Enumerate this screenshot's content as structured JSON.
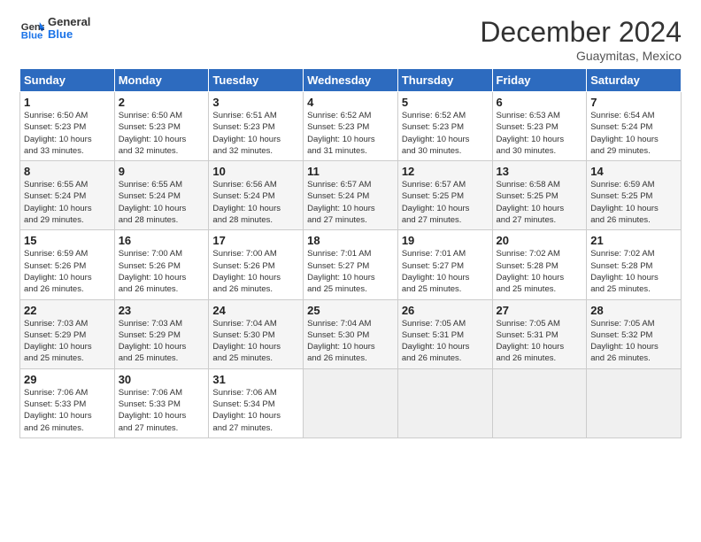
{
  "logo": {
    "line1": "General",
    "line2": "Blue"
  },
  "title": "December 2024",
  "location": "Guaymitas, Mexico",
  "days_header": [
    "Sunday",
    "Monday",
    "Tuesday",
    "Wednesday",
    "Thursday",
    "Friday",
    "Saturday"
  ],
  "weeks": [
    [
      {
        "day": "1",
        "info": "Sunrise: 6:50 AM\nSunset: 5:23 PM\nDaylight: 10 hours\nand 33 minutes."
      },
      {
        "day": "2",
        "info": "Sunrise: 6:50 AM\nSunset: 5:23 PM\nDaylight: 10 hours\nand 32 minutes."
      },
      {
        "day": "3",
        "info": "Sunrise: 6:51 AM\nSunset: 5:23 PM\nDaylight: 10 hours\nand 32 minutes."
      },
      {
        "day": "4",
        "info": "Sunrise: 6:52 AM\nSunset: 5:23 PM\nDaylight: 10 hours\nand 31 minutes."
      },
      {
        "day": "5",
        "info": "Sunrise: 6:52 AM\nSunset: 5:23 PM\nDaylight: 10 hours\nand 30 minutes."
      },
      {
        "day": "6",
        "info": "Sunrise: 6:53 AM\nSunset: 5:23 PM\nDaylight: 10 hours\nand 30 minutes."
      },
      {
        "day": "7",
        "info": "Sunrise: 6:54 AM\nSunset: 5:24 PM\nDaylight: 10 hours\nand 29 minutes."
      }
    ],
    [
      {
        "day": "8",
        "info": "Sunrise: 6:55 AM\nSunset: 5:24 PM\nDaylight: 10 hours\nand 29 minutes."
      },
      {
        "day": "9",
        "info": "Sunrise: 6:55 AM\nSunset: 5:24 PM\nDaylight: 10 hours\nand 28 minutes."
      },
      {
        "day": "10",
        "info": "Sunrise: 6:56 AM\nSunset: 5:24 PM\nDaylight: 10 hours\nand 28 minutes."
      },
      {
        "day": "11",
        "info": "Sunrise: 6:57 AM\nSunset: 5:24 PM\nDaylight: 10 hours\nand 27 minutes."
      },
      {
        "day": "12",
        "info": "Sunrise: 6:57 AM\nSunset: 5:25 PM\nDaylight: 10 hours\nand 27 minutes."
      },
      {
        "day": "13",
        "info": "Sunrise: 6:58 AM\nSunset: 5:25 PM\nDaylight: 10 hours\nand 27 minutes."
      },
      {
        "day": "14",
        "info": "Sunrise: 6:59 AM\nSunset: 5:25 PM\nDaylight: 10 hours\nand 26 minutes."
      }
    ],
    [
      {
        "day": "15",
        "info": "Sunrise: 6:59 AM\nSunset: 5:26 PM\nDaylight: 10 hours\nand 26 minutes."
      },
      {
        "day": "16",
        "info": "Sunrise: 7:00 AM\nSunset: 5:26 PM\nDaylight: 10 hours\nand 26 minutes."
      },
      {
        "day": "17",
        "info": "Sunrise: 7:00 AM\nSunset: 5:26 PM\nDaylight: 10 hours\nand 26 minutes."
      },
      {
        "day": "18",
        "info": "Sunrise: 7:01 AM\nSunset: 5:27 PM\nDaylight: 10 hours\nand 25 minutes."
      },
      {
        "day": "19",
        "info": "Sunrise: 7:01 AM\nSunset: 5:27 PM\nDaylight: 10 hours\nand 25 minutes."
      },
      {
        "day": "20",
        "info": "Sunrise: 7:02 AM\nSunset: 5:28 PM\nDaylight: 10 hours\nand 25 minutes."
      },
      {
        "day": "21",
        "info": "Sunrise: 7:02 AM\nSunset: 5:28 PM\nDaylight: 10 hours\nand 25 minutes."
      }
    ],
    [
      {
        "day": "22",
        "info": "Sunrise: 7:03 AM\nSunset: 5:29 PM\nDaylight: 10 hours\nand 25 minutes."
      },
      {
        "day": "23",
        "info": "Sunrise: 7:03 AM\nSunset: 5:29 PM\nDaylight: 10 hours\nand 25 minutes."
      },
      {
        "day": "24",
        "info": "Sunrise: 7:04 AM\nSunset: 5:30 PM\nDaylight: 10 hours\nand 25 minutes."
      },
      {
        "day": "25",
        "info": "Sunrise: 7:04 AM\nSunset: 5:30 PM\nDaylight: 10 hours\nand 26 minutes."
      },
      {
        "day": "26",
        "info": "Sunrise: 7:05 AM\nSunset: 5:31 PM\nDaylight: 10 hours\nand 26 minutes."
      },
      {
        "day": "27",
        "info": "Sunrise: 7:05 AM\nSunset: 5:31 PM\nDaylight: 10 hours\nand 26 minutes."
      },
      {
        "day": "28",
        "info": "Sunrise: 7:05 AM\nSunset: 5:32 PM\nDaylight: 10 hours\nand 26 minutes."
      }
    ],
    [
      {
        "day": "29",
        "info": "Sunrise: 7:06 AM\nSunset: 5:33 PM\nDaylight: 10 hours\nand 26 minutes."
      },
      {
        "day": "30",
        "info": "Sunrise: 7:06 AM\nSunset: 5:33 PM\nDaylight: 10 hours\nand 27 minutes."
      },
      {
        "day": "31",
        "info": "Sunrise: 7:06 AM\nSunset: 5:34 PM\nDaylight: 10 hours\nand 27 minutes."
      },
      {
        "day": "",
        "info": ""
      },
      {
        "day": "",
        "info": ""
      },
      {
        "day": "",
        "info": ""
      },
      {
        "day": "",
        "info": ""
      }
    ]
  ]
}
